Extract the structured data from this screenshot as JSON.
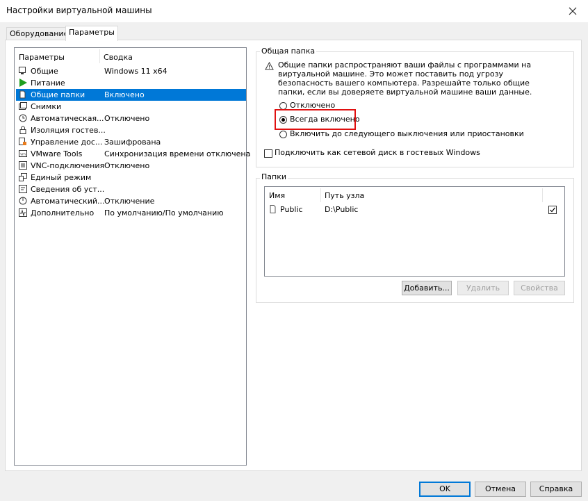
{
  "window": {
    "title": "Настройки виртуальной машины"
  },
  "tabs": [
    {
      "label": "Оборудование",
      "active": false
    },
    {
      "label": "Параметры",
      "active": true
    }
  ],
  "options_list": {
    "columns": [
      "Параметры",
      "Сводка"
    ],
    "items": [
      {
        "icon": "monitor-icon",
        "name": "Общие",
        "summary": "Windows 11 x64"
      },
      {
        "icon": "power-play-icon",
        "name": "Питание",
        "summary": ""
      },
      {
        "icon": "shared-folder-icon",
        "name": "Общие папки",
        "summary": "Включено"
      },
      {
        "icon": "snapshot-icon",
        "name": "Снимки",
        "summary": ""
      },
      {
        "icon": "clock-icon",
        "name": "Автоматическая...",
        "summary": "Отключено"
      },
      {
        "icon": "lock-icon",
        "name": "Изоляция гостев...",
        "summary": ""
      },
      {
        "icon": "access-control-icon",
        "name": "Управление дос...",
        "summary": "Зашифрована"
      },
      {
        "icon": "vm-icon",
        "name": "VMware Tools",
        "summary": "Синхронизация времени отключена"
      },
      {
        "icon": "vnc-icon",
        "name": "VNC-подключения",
        "summary": "Отключено"
      },
      {
        "icon": "unity-icon",
        "name": "Единый режим",
        "summary": ""
      },
      {
        "icon": "info-icon",
        "name": "Сведения об уст...",
        "summary": ""
      },
      {
        "icon": "autoprotect-icon",
        "name": "Автоматический...",
        "summary": "Отключение"
      },
      {
        "icon": "advanced-icon",
        "name": "Дополнительно",
        "summary": "По умолчанию/По умолчанию"
      }
    ],
    "selected_index": 2
  },
  "shared_folder": {
    "group_label": "Общая папка",
    "warning_icon": "warning-triangle-icon",
    "warning_lines": [
      "Общие папки распространяют ваши файлы с программами на",
      "виртуальной машине. Это может поставить под угрозу",
      "безопасность вашего компьютера. Разрешайте только общие",
      "папки, если вы доверяете виртуальной машине ваши данные."
    ],
    "options": [
      {
        "label": "Отключено",
        "selected": false
      },
      {
        "label": "Всегда включено",
        "selected": true
      },
      {
        "label": "Включить до следующего выключения или приостановки",
        "selected": false
      }
    ],
    "map_drive_label": "Подключить как сетевой диск в гостевых Windows",
    "map_drive_checked": false
  },
  "folders": {
    "group_label": "Папки",
    "columns": [
      "Имя",
      "Путь узла"
    ],
    "rows": [
      {
        "name": "Public",
        "path": "D:\\Public",
        "enabled": true
      }
    ],
    "buttons": {
      "add": "Добавить...",
      "remove": "Удалить",
      "properties": "Свойства"
    }
  },
  "footer": {
    "ok": "OK",
    "cancel": "Отмена",
    "help": "Справка"
  },
  "colors": {
    "selection": "#0078d7",
    "highlight_box": "#e01010",
    "play_green": "#1e9e1e"
  }
}
